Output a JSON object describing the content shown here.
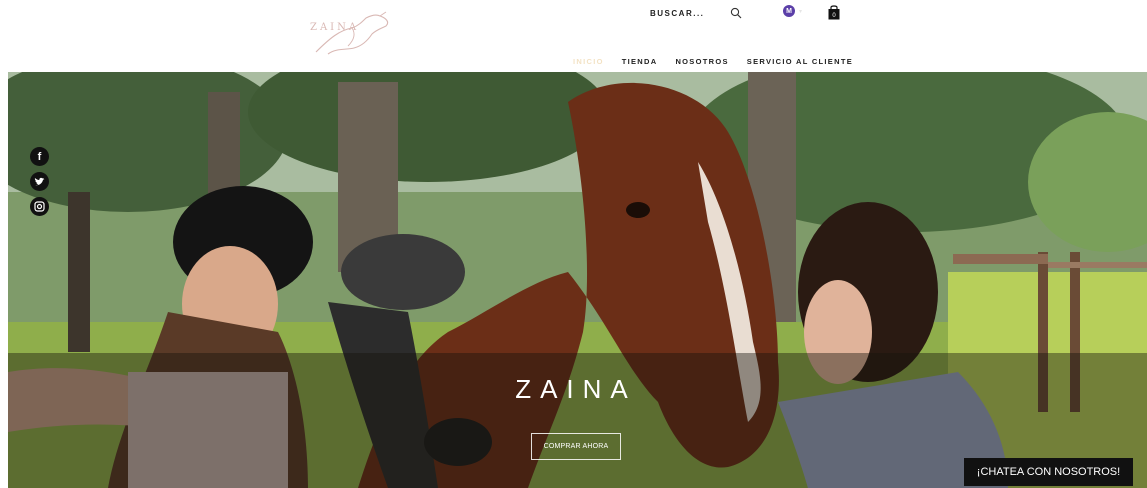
{
  "header": {
    "logo_text": "ZAINA",
    "search_label": "BUSCAR...",
    "member_initial": "M",
    "cart_count": "0"
  },
  "nav": {
    "items": [
      "INICIO",
      "TIENDA",
      "NOSOTROS",
      "SERVICIO AL CLIENTE"
    ],
    "active": "INICIO"
  },
  "hero": {
    "title": "ZAINA",
    "cta_label": "COMPRAR AHORA"
  },
  "social": [
    "facebook-icon",
    "twitter-icon",
    "instagram-icon"
  ],
  "chat": {
    "label": "¡CHATEA CON NOSOTROS!"
  },
  "colors": {
    "member_badge": "#5b3fa8",
    "active_nav": "#f3e2c4",
    "chat_bg": "#111111"
  }
}
